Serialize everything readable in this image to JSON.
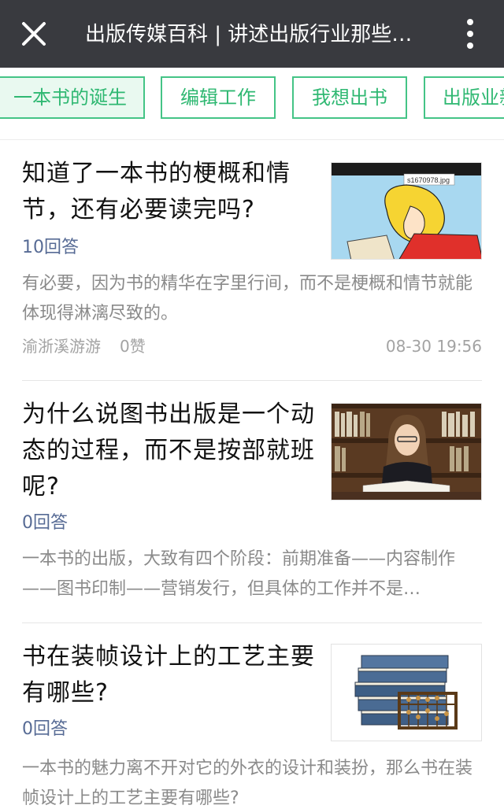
{
  "header": {
    "title": "出版传媒百科 | 讲述出版行业那些…",
    "close_icon": "close-icon",
    "more_icon": "more-vertical-icon"
  },
  "tabs": [
    {
      "label": "一本书的诞生",
      "active": true
    },
    {
      "label": "编辑工作",
      "active": false
    },
    {
      "label": "我想出书",
      "active": false
    },
    {
      "label": "出版业新",
      "active": false
    }
  ],
  "questions": [
    {
      "title": "知道了一本书的梗概和情节，还有必要读完吗?",
      "answers": "10回答",
      "excerpt": "有必要，因为书的精华在字里行间，而不是梗概和情节就能体现得淋漓尽致的。",
      "author": "渝浙溪游游",
      "likes": "0赞",
      "time": "08-30 19:56",
      "image_caption": "s1670978.jpg"
    },
    {
      "title": "为什么说图书出版是一个动态的过程，而不是按部就班呢?",
      "answers": "0回答",
      "excerpt": "一本书的出版，大致有四个阶段：前期准备——内容制作——图书印制——营销发行，但具体的工作并不是…"
    },
    {
      "title": "书在装帧设计上的工艺主要有哪些?",
      "answers": "0回答",
      "excerpt": "一本书的魅力离不开对它的外衣的设计和装扮，那么书在装帧设计上的工艺主要有哪些?"
    }
  ],
  "colors": {
    "header_bg": "#393a3f",
    "tab_green": "#44c486",
    "answer_blue": "#576b95"
  }
}
